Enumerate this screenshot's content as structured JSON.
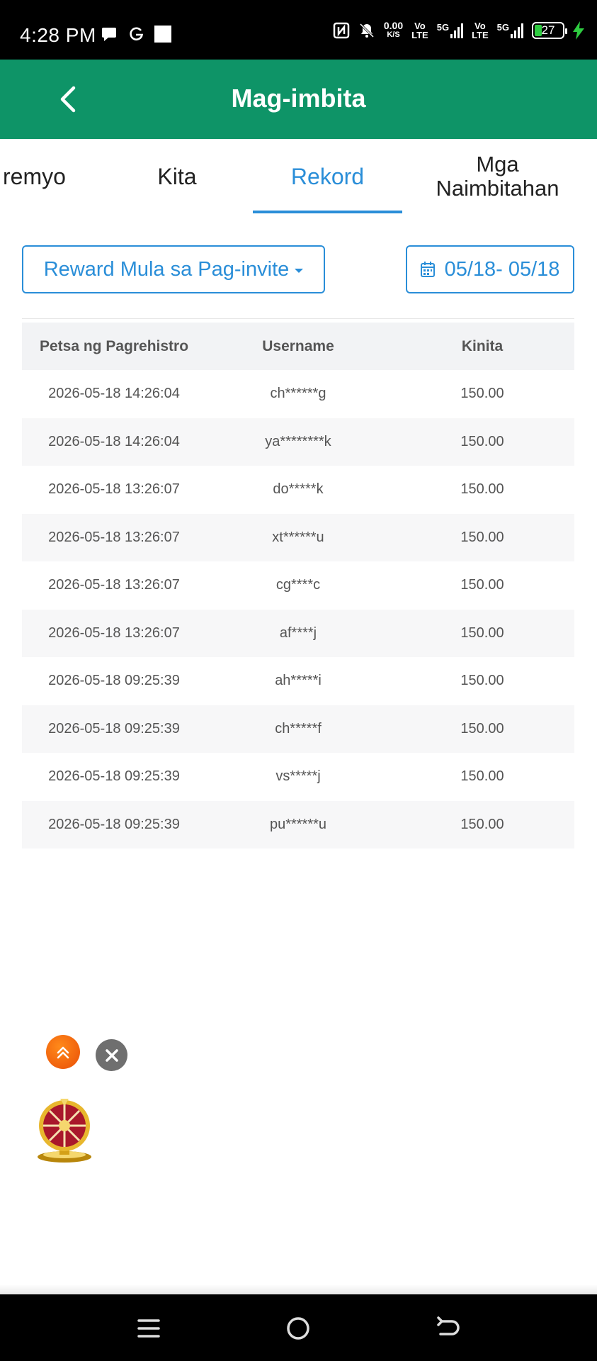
{
  "status_bar": {
    "time": "4:28 PM",
    "net_speed_value": "0.00",
    "net_speed_unit": "K/S",
    "volte1_top": "Vo",
    "volte1_bottom": "LTE",
    "signal1_label": "5G",
    "volte2_top": "Vo",
    "volte2_bottom": "LTE",
    "signal2_label": "5G",
    "battery_level": "27",
    "battery_fill_percent": 27
  },
  "header": {
    "title": "Mag-imbita"
  },
  "tabs": [
    {
      "label": "remyo"
    },
    {
      "label": "Kita"
    },
    {
      "label": "Rekord",
      "active": true
    },
    {
      "label": "Mga Naimbitahan"
    }
  ],
  "filters": {
    "reward_type": "Reward Mula sa Pag-invite",
    "date_range": "05/18- 05/18"
  },
  "table": {
    "columns": [
      "Petsa ng Pagrehistro",
      "Username",
      "Kinita"
    ],
    "rows": [
      [
        "2026-05-18 14:26:04",
        "ch******g",
        "150.00"
      ],
      [
        "2026-05-18 14:26:04",
        "ya********k",
        "150.00"
      ],
      [
        "2026-05-18 13:26:07",
        "do*****k",
        "150.00"
      ],
      [
        "2026-05-18 13:26:07",
        "xt******u",
        "150.00"
      ],
      [
        "2026-05-18 13:26:07",
        "cg****c",
        "150.00"
      ],
      [
        "2026-05-18 13:26:07",
        "af****j",
        "150.00"
      ],
      [
        "2026-05-18 09:25:39",
        "ah*****i",
        "150.00"
      ],
      [
        "2026-05-18 09:25:39",
        "ch*****f",
        "150.00"
      ],
      [
        "2026-05-18 09:25:39",
        "vs*****j",
        "150.00"
      ],
      [
        "2026-05-18 09:25:39",
        "pu******u",
        "150.00"
      ]
    ]
  },
  "colors": {
    "header_green": "#0e9467",
    "accent_blue": "#2a8ed8",
    "fab_orange": "#f36b0c",
    "close_gray": "#6f6f6f"
  },
  "icons": {
    "back": "chevron-left-icon",
    "calendar": "calendar-icon",
    "scroll_top": "double-chevron-up-icon",
    "close": "close-icon",
    "wheel": "prize-wheel-icon"
  }
}
